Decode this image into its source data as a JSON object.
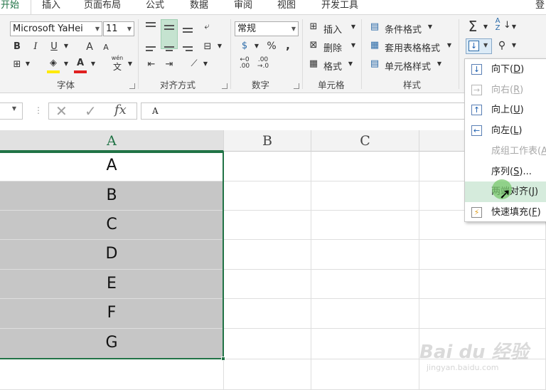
{
  "tabs": [
    "开始",
    "插入",
    "页面布局",
    "公式",
    "数据",
    "审阅",
    "视图",
    "开发工具"
  ],
  "login": "登",
  "font": {
    "name": "Microsoft YaHei",
    "size": "11",
    "bold": "B",
    "italic": "I",
    "underline": "U",
    "grow": "A",
    "shrink": "A",
    "phonetic_top": "wén",
    "phonetic": "文"
  },
  "groups": {
    "font": "字体",
    "alignment": "对齐方式",
    "number": "数字",
    "cells": "单元格",
    "styles": "样式"
  },
  "number_format": "常规",
  "number_buttons": {
    "percent": "%",
    "comma": ",",
    "inc_decimal_top": "←0",
    "inc_decimal_bottom": ".00",
    "dec_decimal_top": ".00",
    "dec_decimal_bottom": "→.0"
  },
  "cells_buttons": {
    "insert": "插入",
    "delete": "删除",
    "format": "格式"
  },
  "styles_buttons": {
    "conditional": "条件格式",
    "table": "套用表格格式",
    "cell": "单元格样式"
  },
  "editing_icons": {
    "sum": "Σ",
    "sort": "A",
    "sort_bottom": "Z",
    "find": "find-icon"
  },
  "formula_bar": {
    "cancel": "✕",
    "enter": "✓",
    "fx": "fx",
    "value": "A"
  },
  "columns": [
    "A",
    "B",
    "C"
  ],
  "cells": [
    "A",
    "B",
    "C",
    "D",
    "E",
    "F",
    "G"
  ],
  "menu": [
    {
      "label": "向下",
      "key": "D",
      "icon": "↓",
      "disabled": false,
      "highlighted": false
    },
    {
      "label": "向右",
      "key": "R",
      "icon": "→",
      "disabled": true,
      "highlighted": false
    },
    {
      "label": "向上",
      "key": "U",
      "icon": "↑",
      "disabled": false,
      "highlighted": false
    },
    {
      "label": "向左",
      "key": "L",
      "icon": "←",
      "disabled": false,
      "highlighted": false
    },
    {
      "label": "成组工作表",
      "key": "A",
      "icon": "",
      "disabled": true,
      "highlighted": false
    },
    {
      "label": "序列",
      "key": "S",
      "suffix": "...",
      "icon": "",
      "disabled": false,
      "highlighted": false
    },
    {
      "label": "两端对齐",
      "key": "J",
      "icon": "",
      "disabled": false,
      "highlighted": true
    },
    {
      "label": "快速填充",
      "key": "F",
      "icon": "⚡",
      "disabled": false,
      "highlighted": false
    }
  ],
  "watermark": {
    "main": "Bai du 经验",
    "sub": "jingyan.baidu.com"
  },
  "colors": {
    "accent": "#217346",
    "selection": "#c6c6c6",
    "highlight": "#d5ebdc"
  }
}
